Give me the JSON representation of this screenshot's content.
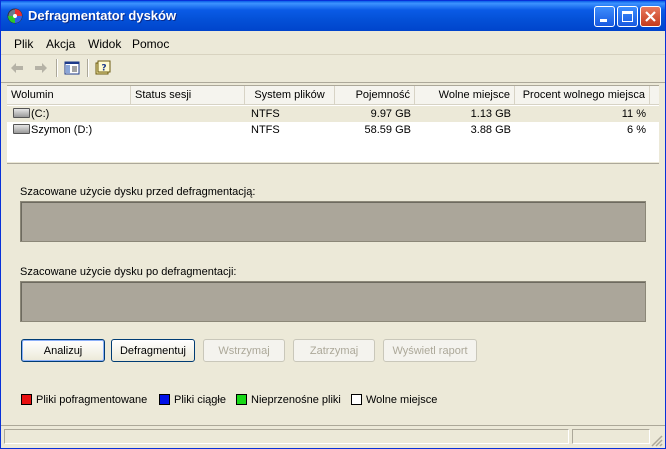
{
  "window": {
    "title": "Defragmentator dysków"
  },
  "menu": [
    "Plik",
    "Akcja",
    "Widok",
    "Pomoc"
  ],
  "toolbar": {
    "back_icon": "back-arrow-icon",
    "forward_icon": "forward-arrow-icon",
    "console_icon": "show-hide-console-tree-icon",
    "help_icon": "help-icon"
  },
  "volumes": {
    "columns": [
      "Wolumin",
      "Status sesji",
      "System plików",
      "Pojemność",
      "Wolne miejsce",
      "Procent wolnego miejsca"
    ],
    "rows": [
      {
        "name": "(C:)",
        "status": "",
        "fs": "NTFS",
        "capacity": "9.97 GB",
        "free": "1.13 GB",
        "percent": "11 %"
      },
      {
        "name": "Szymon (D:)",
        "status": "",
        "fs": "NTFS",
        "capacity": "58.59 GB",
        "free": "3.88 GB",
        "percent": "6 %"
      }
    ]
  },
  "analysis": {
    "before_label": "Szacowane użycie dysku przed defragmentacją:",
    "after_label": "Szacowane użycie dysku po defragmentacji:"
  },
  "buttons": {
    "analyze": "Analizuj",
    "defragment": "Defragmentuj",
    "pause": "Wstrzymaj",
    "stop": "Zatrzymaj",
    "report": "Wyświetl raport"
  },
  "legend": [
    {
      "label": "Pliki pofragmentowane",
      "color": "#e81010"
    },
    {
      "label": "Pliki ciągłe",
      "color": "#0010e8"
    },
    {
      "label": "Nieprzenośne pliki",
      "color": "#18d818"
    },
    {
      "label": "Wolne miejsce",
      "color": "#ffffff"
    }
  ]
}
